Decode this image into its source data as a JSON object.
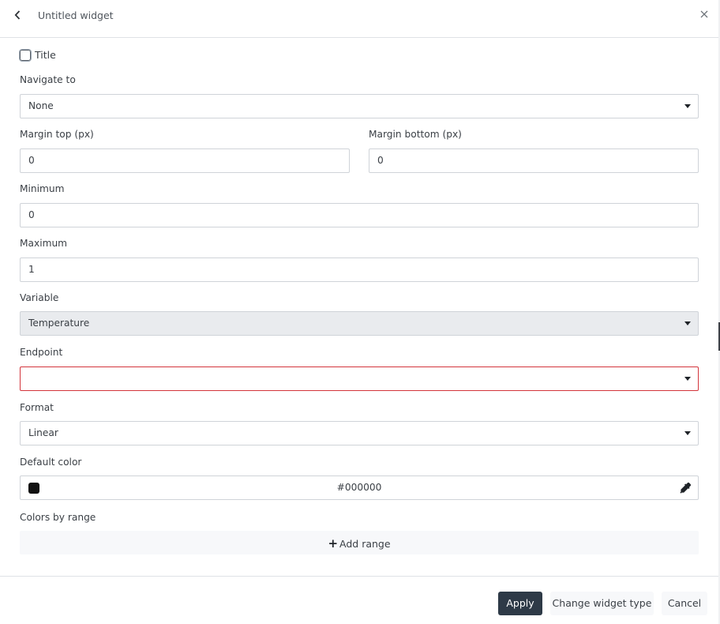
{
  "header": {
    "title": "Untitled widget",
    "back_icon": "chevron-left-icon",
    "close_icon": "close-icon"
  },
  "form": {
    "title_checkbox": {
      "label": "Title",
      "checked": false
    },
    "navigate_to": {
      "label": "Navigate to",
      "value": "None"
    },
    "margin_top": {
      "label": "Margin top (px)",
      "value": "0"
    },
    "margin_bottom": {
      "label": "Margin bottom (px)",
      "value": "0"
    },
    "minimum": {
      "label": "Minimum",
      "value": "0"
    },
    "maximum": {
      "label": "Maximum",
      "value": "1"
    },
    "variable": {
      "label": "Variable",
      "value": "Temperature",
      "disabled": true
    },
    "endpoint": {
      "label": "Endpoint",
      "value": "",
      "error": true
    },
    "format": {
      "label": "Format",
      "value": "Linear"
    },
    "default_color": {
      "label": "Default color",
      "value": "#000000",
      "swatch": "#111111",
      "picker_icon": "eyedropper-icon"
    },
    "colors_by_range": {
      "label": "Colors by range",
      "add_label": "Add range"
    }
  },
  "footer": {
    "apply_label": "Apply",
    "change_type_label": "Change widget type",
    "cancel_label": "Cancel"
  },
  "colors": {
    "primary_button": "#2e3a47",
    "error_border": "#d3343b",
    "disabled_bg": "#e9ebee"
  }
}
